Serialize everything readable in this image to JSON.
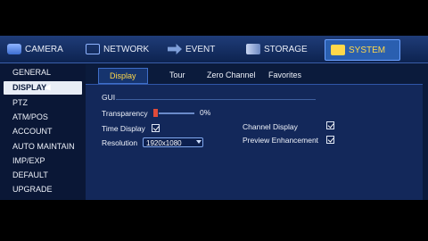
{
  "menu": {
    "camera": "CAMERA",
    "network": "NETWORK",
    "event": "EVENT",
    "storage": "STORAGE",
    "system": "SYSTEM"
  },
  "sidebar": {
    "items": [
      {
        "label": "GENERAL"
      },
      {
        "label": "DISPLAY"
      },
      {
        "label": "PTZ"
      },
      {
        "label": "ATM/POS"
      },
      {
        "label": "ACCOUNT"
      },
      {
        "label": "AUTO MAINTAIN"
      },
      {
        "label": "IMP/EXP"
      },
      {
        "label": "DEFAULT"
      },
      {
        "label": "UPGRADE"
      }
    ]
  },
  "subtabs": {
    "display": "Display",
    "tour": "Tour",
    "zero_channel": "Zero Channel",
    "favorites": "Favorites"
  },
  "gui": {
    "section": "GUI",
    "transparency_label": "Transparency",
    "transparency_value": "0%",
    "time_display_label": "Time Display",
    "time_display_checked": true,
    "resolution_label": "Resolution",
    "resolution_value": "1920x1080",
    "channel_display_label": "Channel Display",
    "channel_display_checked": true,
    "preview_enhancement_label": "Preview Enhancement",
    "preview_enhancement_checked": true
  },
  "colors": {
    "accent": "#ffd84a",
    "background": "#0b1b3c"
  }
}
